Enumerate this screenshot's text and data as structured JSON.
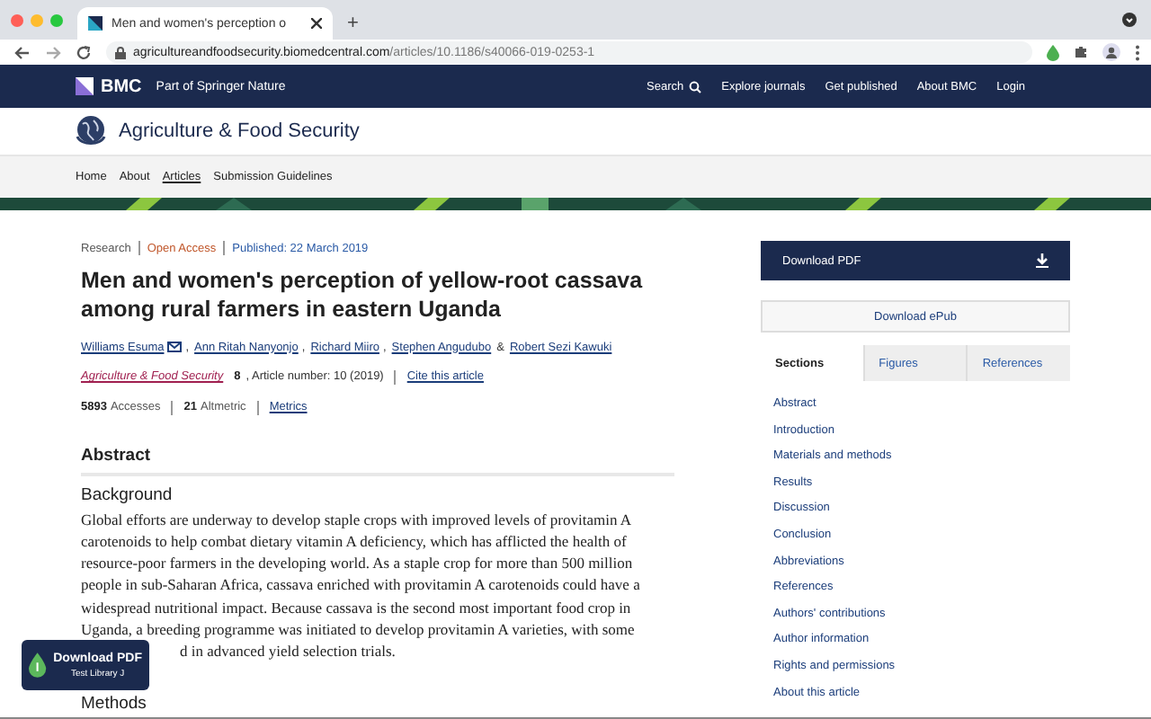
{
  "browser": {
    "tab_title": "Men and women's perception o",
    "new_tab": "+",
    "url_host": "agricultureandfoodsecurity.biomedcentral.com",
    "url_path": "/articles/10.1186/s40066-019-0253-1"
  },
  "site_nav": {
    "brand": "BMC",
    "tagline": "Part of Springer Nature",
    "links": [
      {
        "label": "Search",
        "kind": "search"
      },
      {
        "label": "Explore journals",
        "kind": "link"
      },
      {
        "label": "Get published",
        "kind": "link"
      },
      {
        "label": "About BMC",
        "kind": "link"
      },
      {
        "label": "Login",
        "kind": "link"
      }
    ]
  },
  "journal": {
    "title": "Agriculture & Food Security"
  },
  "journal_nav": [
    {
      "label": "Home",
      "selected": false
    },
    {
      "label": "About",
      "selected": false
    },
    {
      "label": "Articles",
      "selected": true
    },
    {
      "label": "Submission Guidelines",
      "selected": false
    }
  ],
  "article": {
    "type": "Research",
    "access": "Open Access",
    "published": "Published: 22 March 2019",
    "title": "Men and women's perception of yellow-root cassava among rural farmers in eastern Uganda",
    "authors": [
      {
        "name": "Williams Esuma",
        "mail": true,
        "sep": ","
      },
      {
        "name": "Ann Ritah Nanyonjo",
        "mail": false,
        "sep": ","
      },
      {
        "name": "Richard Miiro",
        "mail": false,
        "sep": ","
      },
      {
        "name": "Stephen Angudubo",
        "mail": false,
        "sep": "&"
      },
      {
        "name": "Robert Sezi Kawuki",
        "mail": false
      }
    ],
    "journal_link": "Agriculture & Food Security",
    "volume": "8",
    "article_number": ", Article number: 10 (2019)",
    "cite": "Cite this article",
    "metrics": [
      {
        "value": "5893",
        "label": "Accesses"
      },
      {
        "value": "21",
        "label": "Altmetric"
      }
    ],
    "metrics_link": "Metrics",
    "abstract_heading": "Abstract",
    "background_heading": "Background",
    "background_lines": [
      "Global efforts are underway to develop staple crops with improved levels of provitamin A",
      "carotenoids to help combat dietary vitamin A deficiency, which has afflicted the health of",
      "resource-poor farmers in the developing world. As a staple crop for more than 500 million",
      "people in sub-Saharan Africa, cassava enriched with provitamin A carotenoids could have a",
      "widespread nutritional impact. Because cassava is the second most important food crop in",
      "Uganda, a breeding programme was initiated to develop provitamin A varieties, with some"
    ],
    "background_tail": "d in advanced yield selection trials.",
    "methods_heading": "Methods"
  },
  "sidebar": {
    "download_pdf": "Download PDF",
    "download_epub": "Download ePub",
    "tabs": [
      {
        "label": "Sections",
        "selected": true
      },
      {
        "label": "Figures",
        "selected": false
      },
      {
        "label": "References",
        "selected": false
      }
    ],
    "sections": [
      "Abstract",
      "Introduction",
      "Materials and methods",
      "Results",
      "Discussion",
      "Conclusion",
      "Abbreviations",
      "References",
      "Authors' contributions",
      "Author information",
      "Rights and permissions",
      "About this article"
    ]
  },
  "overlay": {
    "title": "Download PDF",
    "subtitle": "Test Library J"
  }
}
